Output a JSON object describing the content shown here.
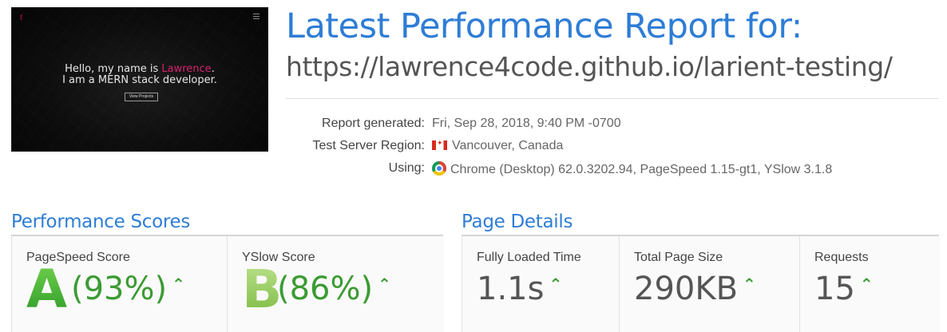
{
  "thumbnail": {
    "logo": "ℓ",
    "line1_prefix": "Hello, my name is ",
    "line1_name": "Lawrence",
    "line1_suffix": ".",
    "line2": "I am a MERN stack developer.",
    "button": "View Projects"
  },
  "header": {
    "title": "Latest Performance Report for:",
    "url": "https://lawrence4code.github.io/larient-testing/"
  },
  "meta": {
    "report_generated_label": "Report generated:",
    "report_generated_value": "Fri, Sep 28, 2018, 9:40 PM -0700",
    "region_label": "Test Server Region:",
    "region_value": "Vancouver, Canada",
    "region_icon": "canada-flag-icon",
    "using_label": "Using:",
    "using_value": "Chrome (Desktop) 62.0.3202.94, PageSpeed 1.15-gt1, YSlow 3.1.8",
    "using_icon": "chrome-icon"
  },
  "performance": {
    "title": "Performance Scores",
    "pagespeed": {
      "label": "PageSpeed Score",
      "grade": "A",
      "percent": "(93%)"
    },
    "yslow": {
      "label": "YSlow Score",
      "grade": "B",
      "percent": "(86%)"
    }
  },
  "details": {
    "title": "Page Details",
    "load_time": {
      "label": "Fully Loaded Time",
      "value": "1.1s"
    },
    "page_size": {
      "label": "Total Page Size",
      "value": "290KB"
    },
    "requests": {
      "label": "Requests",
      "value": "15"
    }
  },
  "colors": {
    "accent_blue": "#2e7dd6",
    "grade_green": "#3b9b32",
    "grade_b_green": "#8cc152"
  },
  "trend_icon": "up-arrow-icon"
}
